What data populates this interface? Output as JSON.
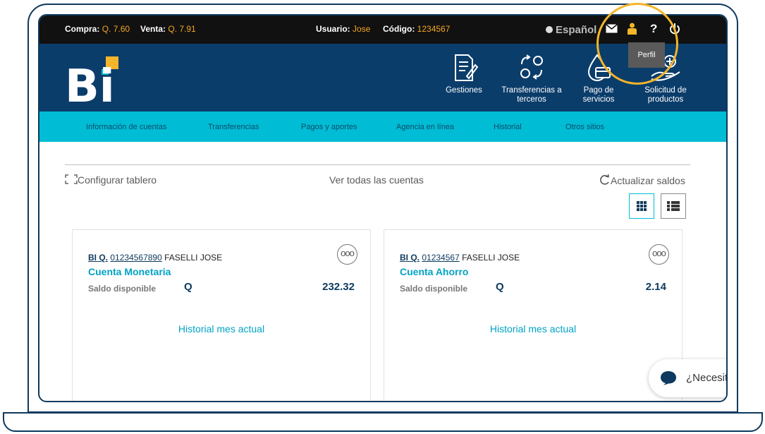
{
  "topbar": {
    "compra_label": "Compra:",
    "compra_value": "Q. 7.60",
    "venta_label": "Venta:",
    "venta_value": "Q. 7.91",
    "usuario_label": "Usuario:",
    "usuario_value": "Jose",
    "codigo_label": "Código:",
    "codigo_value": "1234567",
    "language": "Español",
    "icons": [
      "mail-icon",
      "user-icon",
      "help-icon",
      "power-icon"
    ],
    "help_glyph": "?"
  },
  "tooltip": {
    "text": "Perfil"
  },
  "header": {
    "logo_text": "Bi",
    "nav": [
      {
        "label": "Gestiones",
        "icon": "document-edit-icon"
      },
      {
        "label": "Transferencias a terceros",
        "icon": "transfer-arrows-icon"
      },
      {
        "label": "Pago de servicios",
        "icon": "drop-card-icon"
      },
      {
        "label": "Solicitud de productos",
        "icon": "hand-plus-icon"
      }
    ]
  },
  "subnav": [
    "Información de cuentas",
    "Transferencias",
    "Pagos y aportes",
    "Agencia en línea",
    "Historial",
    "Otros sitios"
  ],
  "dashboard": {
    "configure": "Configurar tablero",
    "view_all": "Ver todas las cuentas",
    "refresh": "Actualizar saldos"
  },
  "accounts": [
    {
      "bank": "BI Q.",
      "number": "01234567890",
      "holder": "FASELLI JOSE",
      "type": "Cuenta Monetaria",
      "balance_label": "Saldo disponible",
      "currency": "Q",
      "amount": "232.32",
      "history": "Historial mes actual",
      "more": "ooo"
    },
    {
      "bank": "BI Q.",
      "number": "01234567",
      "holder": "FASELLI JOSE",
      "type": "Cuenta Ahorro",
      "balance_label": "Saldo disponible",
      "currency": "Q",
      "amount": "2.14",
      "history": "Historial mes actual",
      "more": "ooo"
    }
  ],
  "chat": {
    "text": "¿Necesit"
  },
  "colors": {
    "navy": "#0b3d6b",
    "cyan": "#00bcd4",
    "orange": "#f5a623",
    "highlight": "#f5b52a"
  }
}
